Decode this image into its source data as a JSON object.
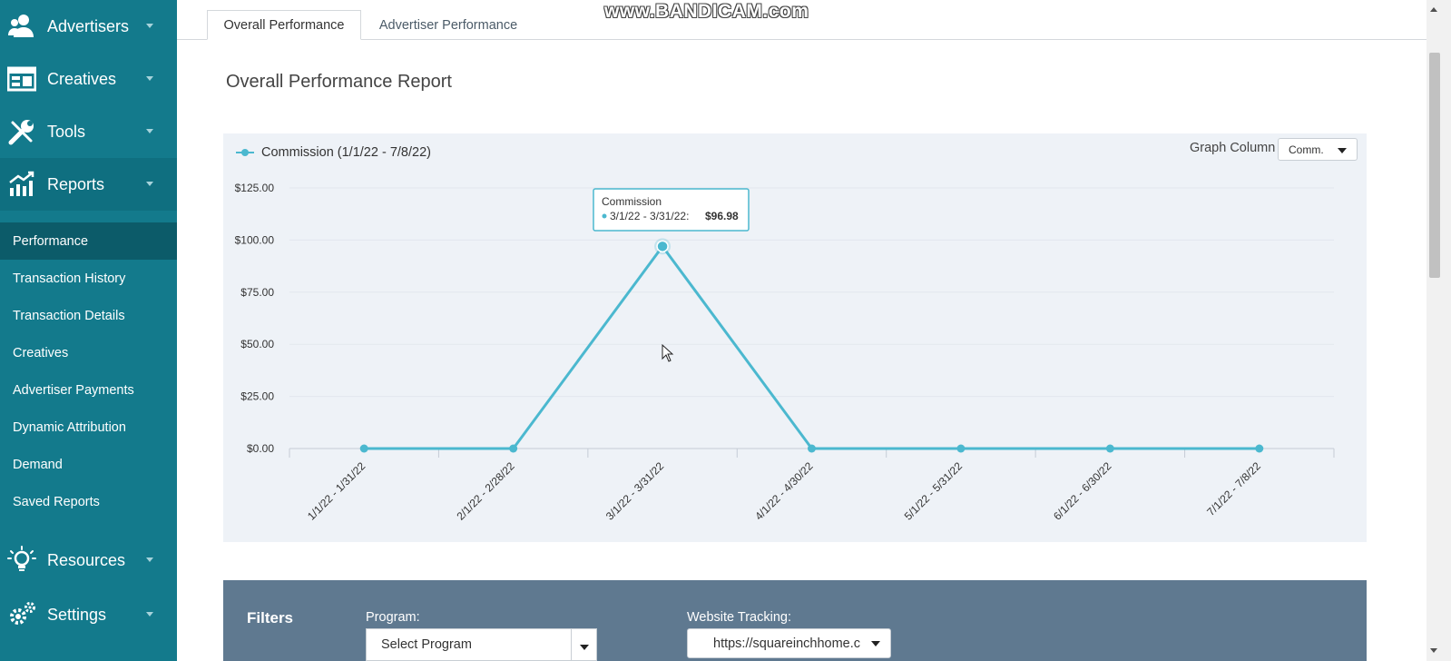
{
  "sidebar": {
    "main_items": [
      {
        "label": "Advertisers",
        "icon": "advertisers-icon"
      },
      {
        "label": "Creatives",
        "icon": "creatives-icon"
      },
      {
        "label": "Tools",
        "icon": "tools-icon"
      },
      {
        "label": "Reports",
        "icon": "reports-icon"
      },
      {
        "label": "Resources",
        "icon": "lightbulb-icon"
      },
      {
        "label": "Settings",
        "icon": "gear-icon"
      }
    ],
    "report_items": [
      {
        "label": "Performance"
      },
      {
        "label": "Transaction History"
      },
      {
        "label": "Transaction Details"
      },
      {
        "label": "Creatives"
      },
      {
        "label": "Advertiser Payments"
      },
      {
        "label": "Dynamic Attribution"
      },
      {
        "label": "Demand"
      },
      {
        "label": "Saved Reports"
      }
    ],
    "colors": {
      "background": "#137a8c",
      "active_sub": "#0c5b69"
    }
  },
  "tabs": [
    {
      "label": "Overall Performance",
      "active": true
    },
    {
      "label": "Advertiser Performance",
      "active": false
    }
  ],
  "watermark": "www.BANDICAM.com",
  "page_title": "Overall Performance Report",
  "chart": {
    "legend_label": "Commission (1/1/22 - 7/8/22)",
    "graph_column_label": "Graph Column",
    "graph_column_value": "Comm.",
    "tooltip": {
      "title": "Commission",
      "period": "3/1/22 - 3/31/22:",
      "value": "$96.98"
    },
    "line_color": "#4bb8cf"
  },
  "chart_data": {
    "type": "line",
    "categories": [
      "1/1/22 - 1/31/22",
      "2/1/22 - 2/28/22",
      "3/1/22 - 3/31/22",
      "4/1/22 - 4/30/22",
      "5/1/22 - 5/31/22",
      "6/1/22 - 6/30/22",
      "7/1/22 - 7/8/22"
    ],
    "series": [
      {
        "name": "Commission (1/1/22 - 7/8/22)",
        "values": [
          0,
          0,
          96.98,
          0,
          0,
          0,
          0
        ]
      }
    ],
    "yticks": [
      "$0.00",
      "$25.00",
      "$50.00",
      "$75.00",
      "$100.00",
      "$125.00"
    ],
    "ylim": [
      0,
      125
    ],
    "grid": true,
    "legend_position": "top-left"
  },
  "filters": {
    "title": "Filters",
    "program_label": "Program:",
    "program_value": "Select Program",
    "website_label": "Website Tracking:",
    "website_value": "https://squareinchhome.c"
  }
}
